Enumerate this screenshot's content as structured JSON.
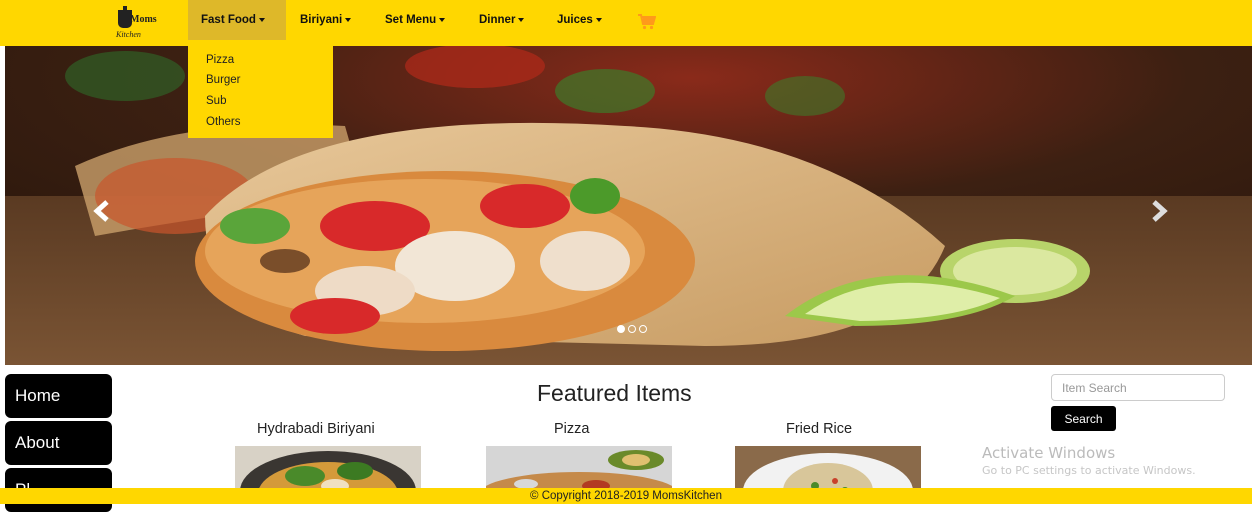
{
  "navbar": {
    "logo": {
      "line1": "Moms",
      "line2": "Kitchen"
    },
    "items": [
      {
        "label": "Fast Food"
      },
      {
        "label": "Biriyani"
      },
      {
        "label": "Set Menu"
      },
      {
        "label": "Dinner"
      },
      {
        "label": "Juices"
      }
    ],
    "cart_icon": "shopping-cart-icon",
    "dropdown": [
      "Pizza",
      "Burger",
      "Sub",
      "Others"
    ]
  },
  "carousel": {
    "slide_count": 3,
    "active_slide": 1,
    "prev_icon": "chevron-left-icon",
    "next_icon": "chevron-right-icon"
  },
  "sidebar": {
    "items": [
      {
        "label": "Home"
      },
      {
        "label": "About"
      },
      {
        "label": "Pl..."
      }
    ]
  },
  "featured": {
    "title": "Featured Items",
    "items": [
      {
        "name": "Hydrabadi Biriyani"
      },
      {
        "name": "Pizza"
      },
      {
        "name": "Fried Rice"
      }
    ]
  },
  "search": {
    "placeholder": "Item Search",
    "button_label": "Search"
  },
  "watermark": {
    "title": "Activate Windows",
    "subtitle": "Go to PC settings to activate Windows."
  },
  "footer": {
    "text": "© Copyright 2018-2019 MomsKitchen"
  },
  "colors": {
    "accent": "#ffd700",
    "active_nav": "#deb829"
  }
}
